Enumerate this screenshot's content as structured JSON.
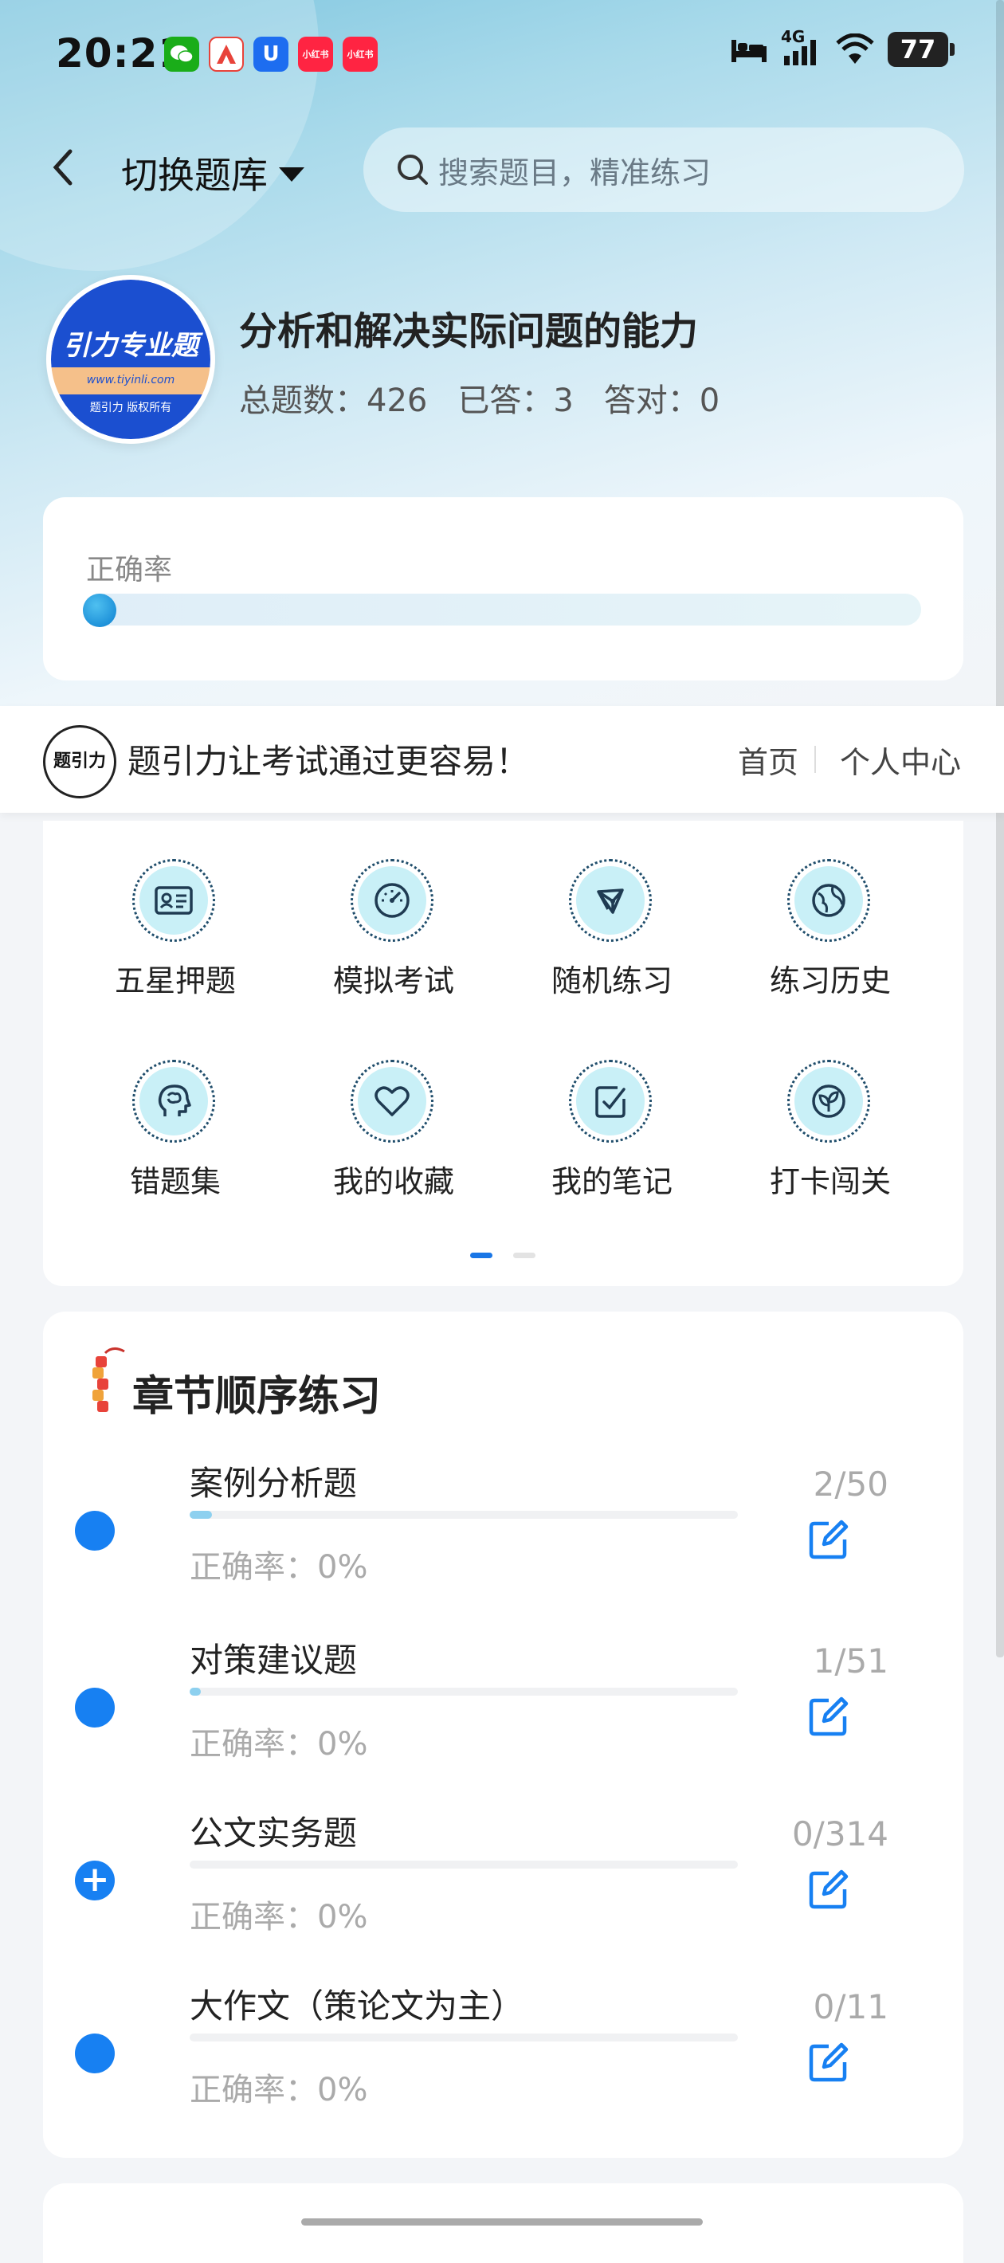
{
  "status_bar": {
    "time": "20:21",
    "network": "4G",
    "battery": "77",
    "app_icons": [
      {
        "name": "wechat-icon",
        "text": "",
        "color": "#1aad19"
      },
      {
        "name": "app-a-icon",
        "text": "",
        "color": "#e8433a"
      },
      {
        "name": "app-u-icon",
        "text": "U",
        "color": "#1d6df0"
      },
      {
        "name": "xiaohongshu-icon",
        "text": "小红书",
        "color": "#ff2442"
      },
      {
        "name": "xiaohongshu-icon-2",
        "text": "小红书",
        "color": "#ff2442"
      }
    ]
  },
  "header": {
    "switch_label": "切换题库",
    "search_placeholder": "搜索题目，精准练习"
  },
  "bank": {
    "logo_text": "引力专业题",
    "logo_url_text": "www.tiyinli.com",
    "logo_footer": "题引力 版权所有",
    "title": "分析和解决实际问题的能力",
    "total": "总题数：426",
    "answered": "已答：3",
    "correct": "答对：0"
  },
  "accuracy": {
    "label": "正确率",
    "value_fraction": 0
  },
  "banner": {
    "brand": "题引力",
    "slogan": "题引力让考试通过更容易！",
    "nav_home": "首页",
    "nav_profile": "个人中心"
  },
  "functions": [
    {
      "label": "五星押题",
      "icon": "id-card-icon"
    },
    {
      "label": "模拟考试",
      "icon": "gauge-icon"
    },
    {
      "label": "随机练习",
      "icon": "network-icon"
    },
    {
      "label": "练习历史",
      "icon": "globe-icon"
    },
    {
      "label": "错题集",
      "icon": "brain-head-icon"
    },
    {
      "label": "我的收藏",
      "icon": "heart-icon"
    },
    {
      "label": "我的笔记",
      "icon": "note-check-icon"
    },
    {
      "label": "打卡闯关",
      "icon": "sprout-icon"
    }
  ],
  "pager": {
    "active": 0,
    "pages": 2
  },
  "chapters": {
    "title": "章节顺序练习",
    "items": [
      {
        "name": "案例分析题",
        "accuracy": "正确率：0%",
        "count": "2/50",
        "progress": 0.04,
        "marker": "dot"
      },
      {
        "name": "对策建议题",
        "accuracy": "正确率：0%",
        "count": "1/51",
        "progress": 0.02,
        "marker": "dot"
      },
      {
        "name": "公文实务题",
        "accuracy": "正确率：0%",
        "count": "0/314",
        "progress": 0,
        "marker": "plus"
      },
      {
        "name": "大作文（策论文为主）",
        "accuracy": "正确率：0%",
        "count": "0/11",
        "progress": 0,
        "marker": "dot"
      }
    ]
  },
  "colors": {
    "accent": "#1780f2",
    "progress_fill": "#8dd0ef"
  }
}
